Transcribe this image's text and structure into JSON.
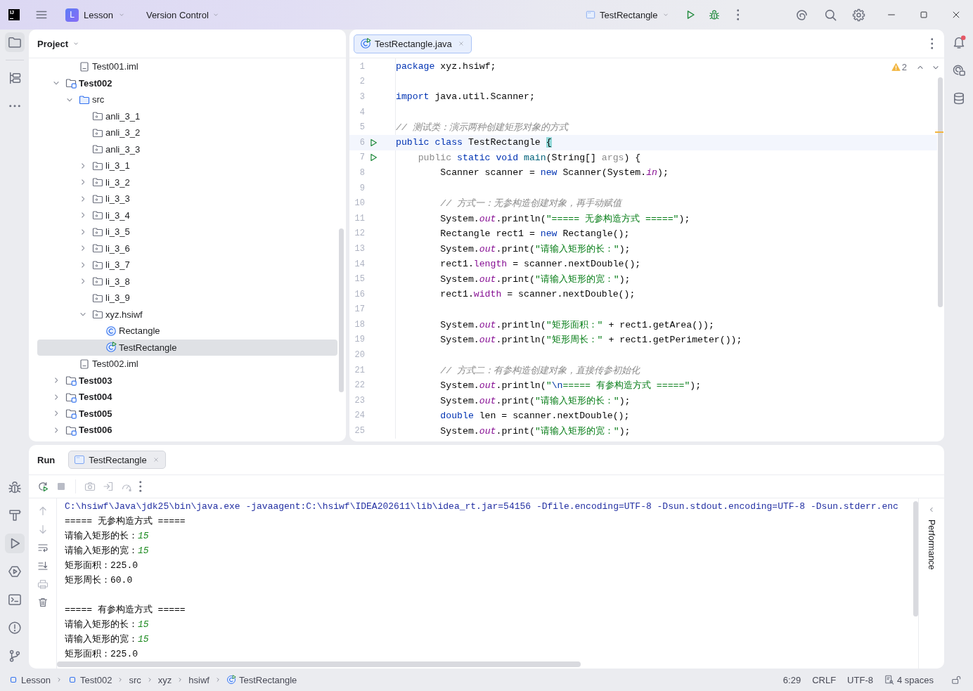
{
  "title_bar": {
    "logo": "IJ",
    "project_initial": "L",
    "project": "Lesson",
    "vcs": "Version Control",
    "run_config": "TestRectangle"
  },
  "tool_strip": {
    "top": [
      {
        "kind": "project",
        "selected": true
      },
      {
        "kind": "structure",
        "selected": false
      },
      {
        "kind": "more",
        "selected": false
      }
    ],
    "bottom": [
      {
        "kind": "debug",
        "selected": false
      },
      {
        "kind": "build",
        "selected": false
      },
      {
        "kind": "run",
        "selected": true
      },
      {
        "kind": "services",
        "selected": false
      },
      {
        "kind": "terminal",
        "selected": false
      },
      {
        "kind": "problems",
        "selected": false
      },
      {
        "kind": "git",
        "selected": false
      }
    ]
  },
  "project_panel": {
    "title": "Project",
    "tree": [
      {
        "children": [
          {
            "label": "Test001.iml",
            "kind": "iml",
            "selected": false
          }
        ]
      },
      {
        "label": "Test002",
        "kind": "module",
        "expanded": true,
        "selected": false,
        "children": [
          {
            "label": "src",
            "kind": "source",
            "expanded": true,
            "selected": false,
            "children": [
              {
                "label": "anli_3_1",
                "kind": "package",
                "selected": false
              },
              {
                "label": "anli_3_2",
                "kind": "package",
                "selected": false
              },
              {
                "label": "anli_3_3",
                "kind": "package",
                "selected": false
              },
              {
                "label": "li_3_1",
                "kind": "package",
                "expanded": false,
                "selected": false
              },
              {
                "label": "li_3_2",
                "kind": "package",
                "expanded": false,
                "selected": false
              },
              {
                "label": "li_3_3",
                "kind": "package",
                "expanded": false,
                "selected": false
              },
              {
                "label": "li_3_4",
                "kind": "package",
                "expanded": false,
                "selected": false
              },
              {
                "label": "li_3_5",
                "kind": "package",
                "expanded": false,
                "selected": false
              },
              {
                "label": "li_3_6",
                "kind": "package",
                "expanded": false,
                "selected": false
              },
              {
                "label": "li_3_7",
                "kind": "package",
                "expanded": false,
                "selected": false
              },
              {
                "label": "li_3_8",
                "kind": "package",
                "expanded": false,
                "selected": false
              },
              {
                "label": "li_3_9",
                "kind": "package",
                "selected": false
              },
              {
                "label": "xyz.hsiwf",
                "kind": "package",
                "expanded": true,
                "selected": false,
                "children": [
                  {
                    "label": "Rectangle",
                    "kind": "class",
                    "selected": false
                  },
                  {
                    "label": "TestRectangle",
                    "kind": "main-class",
                    "selected": true
                  }
                ]
              }
            ]
          },
          {
            "label": "Test002.iml",
            "kind": "iml",
            "selected": false
          }
        ]
      },
      {
        "label": "Test003",
        "kind": "module",
        "expanded": false,
        "selected": false
      },
      {
        "label": "Test004",
        "kind": "module",
        "expanded": false,
        "selected": false
      },
      {
        "label": "Test005",
        "kind": "module",
        "expanded": false,
        "selected": false
      },
      {
        "label": "Test006",
        "kind": "module",
        "expanded": false,
        "selected": false
      }
    ]
  },
  "editor": {
    "tabs": [
      {
        "label": "TestRectangle.java",
        "selected": true
      }
    ],
    "warnings": "2",
    "lines": [
      {
        "number": "1",
        "current": false,
        "run_marker": false,
        "tokens": [
          {
            "kind": "kw",
            "text": "package"
          },
          {
            "kind": "plain",
            "text": " xyz.hsiwf;"
          }
        ]
      },
      {
        "number": "2",
        "current": false,
        "run_marker": false
      },
      {
        "number": "3",
        "current": false,
        "run_marker": false,
        "tokens": [
          {
            "kind": "kw",
            "text": "import"
          },
          {
            "kind": "plain",
            "text": " java.util.Scanner;"
          }
        ]
      },
      {
        "number": "4",
        "current": false,
        "run_marker": false
      },
      {
        "number": "5",
        "current": false,
        "run_marker": false,
        "tokens": [
          {
            "kind": "comment",
            "text": "// 测试类：演示两种创建矩形对象的方式"
          }
        ]
      },
      {
        "number": "6",
        "current": true,
        "run_marker": true,
        "tokens": [
          {
            "kind": "kw",
            "text": "public"
          },
          {
            "kind": "kw",
            "text": " class"
          },
          {
            "kind": "plain",
            "text": " TestRectangle "
          },
          {
            "kind": "match",
            "text": "{"
          }
        ]
      },
      {
        "number": "7",
        "current": false,
        "run_marker": true,
        "tokens": [
          {
            "kind": "muted",
            "text": "    public"
          },
          {
            "kind": "kw",
            "text": " static void"
          },
          {
            "kind": "decl",
            "text": " main"
          },
          {
            "kind": "plain",
            "text": "(String[] "
          },
          {
            "kind": "muted",
            "text": "args"
          },
          {
            "kind": "plain",
            "text": ") {"
          }
        ]
      },
      {
        "number": "8",
        "current": false,
        "run_marker": false,
        "tokens": [
          {
            "kind": "plain",
            "text": "        Scanner scanner = "
          },
          {
            "kind": "kw",
            "text": "new"
          },
          {
            "kind": "plain",
            "text": " Scanner(System."
          },
          {
            "kind": "static",
            "text": "in"
          },
          {
            "kind": "plain",
            "text": ");"
          }
        ]
      },
      {
        "number": "9",
        "current": false,
        "run_marker": false
      },
      {
        "number": "10",
        "current": false,
        "run_marker": false,
        "tokens": [
          {
            "kind": "comment",
            "text": "        // 方式一：无参构造创建对象，再手动赋值"
          }
        ]
      },
      {
        "number": "11",
        "current": false,
        "run_marker": false,
        "tokens": [
          {
            "kind": "plain",
            "text": "        System."
          },
          {
            "kind": "static",
            "text": "out"
          },
          {
            "kind": "plain",
            "text": ".println("
          },
          {
            "kind": "str",
            "text": "\"===== 无参构造方式 =====\""
          },
          {
            "kind": "plain",
            "text": ");"
          }
        ]
      },
      {
        "number": "12",
        "current": false,
        "run_marker": false,
        "tokens": [
          {
            "kind": "plain",
            "text": "        Rectangle rect1 = "
          },
          {
            "kind": "kw",
            "text": "new"
          },
          {
            "kind": "plain",
            "text": " Rectangle();"
          }
        ]
      },
      {
        "number": "13",
        "current": false,
        "run_marker": false,
        "tokens": [
          {
            "kind": "plain",
            "text": "        System."
          },
          {
            "kind": "static",
            "text": "out"
          },
          {
            "kind": "plain",
            "text": ".print("
          },
          {
            "kind": "str",
            "text": "\"请输入矩形的长：\""
          },
          {
            "kind": "plain",
            "text": ");"
          }
        ]
      },
      {
        "number": "14",
        "current": false,
        "run_marker": false,
        "tokens": [
          {
            "kind": "plain",
            "text": "        rect1."
          },
          {
            "kind": "field",
            "text": "length"
          },
          {
            "kind": "plain",
            "text": " = scanner.nextDouble();"
          }
        ]
      },
      {
        "number": "15",
        "current": false,
        "run_marker": false,
        "tokens": [
          {
            "kind": "plain",
            "text": "        System."
          },
          {
            "kind": "static",
            "text": "out"
          },
          {
            "kind": "plain",
            "text": ".print("
          },
          {
            "kind": "str",
            "text": "\"请输入矩形的宽：\""
          },
          {
            "kind": "plain",
            "text": ");"
          }
        ]
      },
      {
        "number": "16",
        "current": false,
        "run_marker": false,
        "tokens": [
          {
            "kind": "plain",
            "text": "        rect1."
          },
          {
            "kind": "field",
            "text": "width"
          },
          {
            "kind": "plain",
            "text": " = scanner.nextDouble();"
          }
        ]
      },
      {
        "number": "17",
        "current": false,
        "run_marker": false
      },
      {
        "number": "18",
        "current": false,
        "run_marker": false,
        "tokens": [
          {
            "kind": "plain",
            "text": "        System."
          },
          {
            "kind": "static",
            "text": "out"
          },
          {
            "kind": "plain",
            "text": ".println("
          },
          {
            "kind": "str",
            "text": "\"矩形面积：\""
          },
          {
            "kind": "plain",
            "text": " + rect1.getArea());"
          }
        ]
      },
      {
        "number": "19",
        "current": false,
        "run_marker": false,
        "tokens": [
          {
            "kind": "plain",
            "text": "        System."
          },
          {
            "kind": "static",
            "text": "out"
          },
          {
            "kind": "plain",
            "text": ".println("
          },
          {
            "kind": "str",
            "text": "\"矩形周长：\""
          },
          {
            "kind": "plain",
            "text": " + rect1.getPerimeter());"
          }
        ]
      },
      {
        "number": "20",
        "current": false,
        "run_marker": false
      },
      {
        "number": "21",
        "current": false,
        "run_marker": false,
        "tokens": [
          {
            "kind": "comment",
            "text": "        // 方式二：有参构造创建对象，直接传参初始化"
          }
        ]
      },
      {
        "number": "22",
        "current": false,
        "run_marker": false,
        "tokens": [
          {
            "kind": "plain",
            "text": "        System."
          },
          {
            "kind": "static",
            "text": "out"
          },
          {
            "kind": "plain",
            "text": ".println("
          },
          {
            "kind": "str",
            "text": "\""
          },
          {
            "kind": "escape",
            "text": "\\n"
          },
          {
            "kind": "str",
            "text": "===== 有参构造方式 =====\""
          },
          {
            "kind": "plain",
            "text": ");"
          }
        ]
      },
      {
        "number": "23",
        "current": false,
        "run_marker": false,
        "tokens": [
          {
            "kind": "plain",
            "text": "        System."
          },
          {
            "kind": "static",
            "text": "out"
          },
          {
            "kind": "plain",
            "text": ".print("
          },
          {
            "kind": "str",
            "text": "\"请输入矩形的长：\""
          },
          {
            "kind": "plain",
            "text": ");"
          }
        ]
      },
      {
        "number": "24",
        "current": false,
        "run_marker": false,
        "tokens": [
          {
            "kind": "kw",
            "text": "        double"
          },
          {
            "kind": "plain",
            "text": " len = scanner.nextDouble();"
          }
        ]
      },
      {
        "number": "25",
        "current": false,
        "run_marker": false,
        "tokens": [
          {
            "kind": "plain",
            "text": "        System."
          },
          {
            "kind": "static",
            "text": "out"
          },
          {
            "kind": "plain",
            "text": ".print("
          },
          {
            "kind": "str",
            "text": "\"请输入矩形的宽：\""
          },
          {
            "kind": "plain",
            "text": ");"
          }
        ]
      }
    ]
  },
  "right_strip": [
    {
      "kind": "notifications",
      "badge": true
    },
    {
      "kind": "ai-chat",
      "badge": false
    },
    {
      "kind": "database",
      "badge": false
    }
  ],
  "run_panel": {
    "title": "Run",
    "tabs": [
      {
        "label": "TestRectangle",
        "selected": true
      }
    ],
    "toolbar": [
      {
        "kind": "rerun",
        "disabled": false
      },
      {
        "kind": "stop",
        "disabled": true
      },
      {
        "kind": "screenshot",
        "disabled": true,
        "separator_before": true
      },
      {
        "kind": "exit",
        "disabled": true
      },
      {
        "kind": "gauge",
        "disabled": true
      },
      {
        "kind": "more",
        "disabled": false
      }
    ],
    "side_tools": [
      {
        "kind": "up",
        "disabled": true
      },
      {
        "kind": "down",
        "disabled": true
      },
      {
        "kind": "wrap",
        "disabled": false
      },
      {
        "kind": "scroll-end",
        "disabled": false
      },
      {
        "kind": "print",
        "disabled": true
      },
      {
        "kind": "trash",
        "disabled": false
      }
    ],
    "console": [
      {
        "segments": [
          {
            "kind": "command",
            "text": "C:\\hsiwf\\Java\\jdk25\\bin\\java.exe -javaagent:C:\\hsiwf\\IDEA202611\\lib\\idea_rt.jar=54156 -Dfile.encoding=UTF-8 -Dsun.stdout.encoding=UTF-8 -Dsun.stderr.enc"
          }
        ]
      },
      {
        "segments": [
          {
            "kind": "output",
            "text": "===== 无参构造方式 ====="
          }
        ]
      },
      {
        "segments": [
          {
            "kind": "output",
            "text": "请输入矩形的长："
          },
          {
            "kind": "input",
            "text": "15"
          }
        ]
      },
      {
        "segments": [
          {
            "kind": "output",
            "text": "请输入矩形的宽："
          },
          {
            "kind": "input",
            "text": "15"
          }
        ]
      },
      {
        "segments": [
          {
            "kind": "output",
            "text": "矩形面积：225.0"
          }
        ]
      },
      {
        "segments": [
          {
            "kind": "output",
            "text": "矩形周长：60.0"
          }
        ]
      },
      {
        "segments": [
          {
            "kind": "output",
            "text": "===== 有参构造方式 ====="
          }
        ],
        "gap_before": true
      },
      {
        "segments": [
          {
            "kind": "output",
            "text": "请输入矩形的长："
          },
          {
            "kind": "input",
            "text": "15"
          }
        ]
      },
      {
        "segments": [
          {
            "kind": "output",
            "text": "请输入矩形的宽："
          },
          {
            "kind": "input",
            "text": "15"
          }
        ]
      },
      {
        "segments": [
          {
            "kind": "output",
            "text": "矩形面积：225.0"
          }
        ]
      }
    ],
    "side_label": "Performance"
  },
  "status_bar": {
    "breadcrumbs": [
      {
        "label": "Lesson",
        "kind": "module"
      },
      {
        "label": "Test002",
        "kind": "module"
      },
      {
        "label": "src",
        "kind": "plain"
      },
      {
        "label": "xyz",
        "kind": "plain"
      },
      {
        "label": "hsiwf",
        "kind": "plain"
      },
      {
        "label": "TestRectangle",
        "kind": "main-class"
      }
    ],
    "items": [
      {
        "label": "6:29",
        "kind": "position"
      },
      {
        "label": "CRLF",
        "kind": "line-separator"
      },
      {
        "label": "UTF-8",
        "kind": "encoding"
      },
      {
        "label": "4 spaces",
        "kind": "indent"
      }
    ]
  }
}
